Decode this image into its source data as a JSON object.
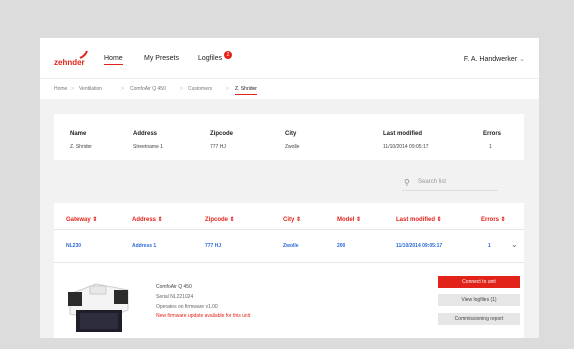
{
  "header": {
    "logo_text": "zehnder",
    "nav": [
      "Home",
      "My Presets",
      "Logfiles"
    ],
    "logfiles_badge": "2",
    "user": "F. A. Handwerker"
  },
  "breadcrumb": [
    "Home",
    "Ventilation",
    "ComfoAir Q 450",
    "Customers",
    "Z. Shrider"
  ],
  "customer": {
    "labels": [
      "Name",
      "Address",
      "Zipcode",
      "City",
      "Last modified",
      "Errors"
    ],
    "values": [
      "Z. Shrider",
      "Streetname 1",
      "777 HJ",
      "Zwolle",
      "11/10/2014 09:05:17",
      "1"
    ]
  },
  "search": {
    "placeholder": "Search list"
  },
  "table": {
    "headers": [
      "Gateway ⇕",
      "Address ⇕",
      "Zipcode ⇕",
      "City ⇕",
      "Model ⇕",
      "Last modified ⇕",
      "Errors ⇕"
    ],
    "row": [
      "NL230",
      "Address 1",
      "777 HJ",
      "Zwolle",
      "200",
      "11/10/2014 09:05:17",
      "1"
    ]
  },
  "device": {
    "name": "ComfoAir Q 450",
    "serial": "Serial NL221024",
    "firmware": "Operates on firmware v1.00",
    "update": "New firmware update available for this unit"
  },
  "buttons": {
    "connect": "Connect to unit",
    "logfiles": "View logfiles (1)",
    "report": "Commissioning report"
  },
  "colors": {
    "accent": "#e2231a",
    "link": "#2a6ad8"
  }
}
